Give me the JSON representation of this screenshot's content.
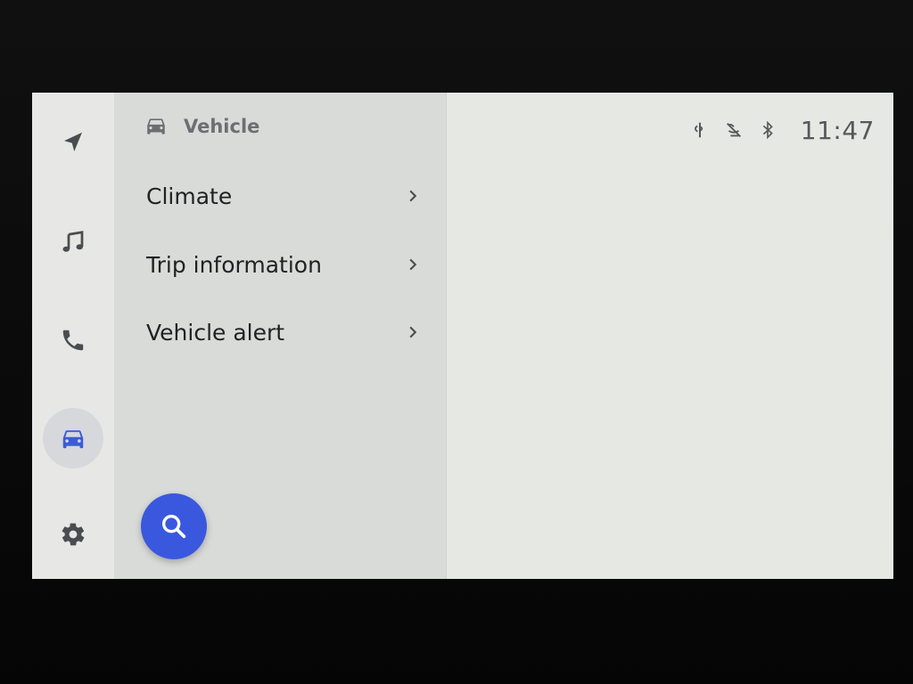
{
  "header": {
    "icon": "car-icon",
    "title": "Vehicle"
  },
  "rail": {
    "items": [
      {
        "name": "navigation",
        "icon": "navigation-arrow-icon"
      },
      {
        "name": "music",
        "icon": "music-note-icon"
      },
      {
        "name": "phone",
        "icon": "phone-icon"
      },
      {
        "name": "vehicle",
        "icon": "car-icon",
        "active": true
      },
      {
        "name": "settings",
        "icon": "gear-icon"
      }
    ]
  },
  "menu": {
    "items": [
      {
        "label": "Climate",
        "icon": "chevron-right-icon"
      },
      {
        "label": "Trip information",
        "icon": "chevron-right-icon"
      },
      {
        "label": "Vehicle alert",
        "icon": "chevron-right-icon"
      }
    ]
  },
  "search": {
    "icon": "search-icon"
  },
  "status": {
    "icons": [
      "wireless-charging-icon",
      "mic-muted-icon",
      "bluetooth-icon"
    ],
    "time": "11:47"
  },
  "colors": {
    "accent": "#3a58de",
    "active_icon": "#3b5bdb",
    "text_primary": "#1f2123",
    "text_secondary": "#6c6f72"
  }
}
